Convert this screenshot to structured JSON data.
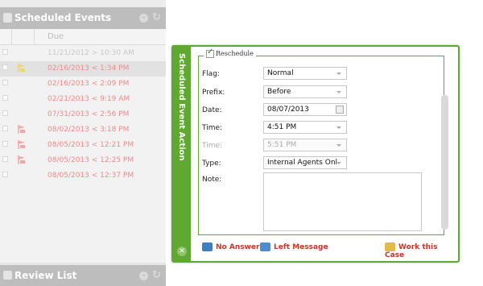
{
  "scheduled_events": {
    "title": "Scheduled Events",
    "column_due": "Due",
    "rows": [
      {
        "due": "11/21/2012 > 10:30 AM",
        "color": "#c8c8c8",
        "flag": false,
        "highlight": false
      },
      {
        "due": "02/16/2013 < 1:34 PM",
        "color": "#f08a8a",
        "flag": true,
        "flag_color": "#f0d66a",
        "highlight": true
      },
      {
        "due": "02/16/2013 < 2:09 PM",
        "color": "#f08a8a",
        "flag": false,
        "highlight": false
      },
      {
        "due": "02/21/2013 < 9:19 AM",
        "color": "#f08a8a",
        "flag": false,
        "highlight": false
      },
      {
        "due": "07/31/2013 < 2:56 PM",
        "color": "#f08a8a",
        "flag": false,
        "highlight": false
      },
      {
        "due": "08/02/2013 < 3:18 PM",
        "color": "#f08a8a",
        "flag": true,
        "flag_color": "#f5a5a5",
        "highlight": false
      },
      {
        "due": "08/05/2013 < 12:21 PM",
        "color": "#f08a8a",
        "flag": true,
        "flag_color": "#f5a5a5",
        "highlight": false
      },
      {
        "due": "08/05/2013 < 12:25 PM",
        "color": "#f08a8a",
        "flag": true,
        "flag_color": "#f5a5a5",
        "highlight": false
      },
      {
        "due": "08/05/2013 < 12:37 PM",
        "color": "#f08a8a",
        "flag": false,
        "highlight": false
      }
    ]
  },
  "review_list": {
    "title": "Review List"
  },
  "action_panel": {
    "side_title": "Scheduled Event Action",
    "reschedule_label": "Reschedule",
    "reschedule_checked": true,
    "fields": {
      "flag": {
        "label": "Flag:",
        "value": "Normal"
      },
      "prefix": {
        "label": "Prefix:",
        "value": "Before"
      },
      "date": {
        "label": "Date:",
        "value": "08/07/2013"
      },
      "time": {
        "label": "Time:",
        "value": "4:51 PM"
      },
      "time2": {
        "label": "Time:",
        "value": "5:51 PM"
      },
      "type": {
        "label": "Type:",
        "value": "Internal Agents Onl"
      },
      "note": {
        "label": "Note:",
        "value": ""
      }
    },
    "actions": {
      "no_answer": "No Answer",
      "left_message": "Left Message",
      "work_case": "Work this Case"
    }
  },
  "colors": {
    "accent_green": "#5fa832",
    "action_red": "#c0392b",
    "overdue_red": "#f08a8a"
  }
}
